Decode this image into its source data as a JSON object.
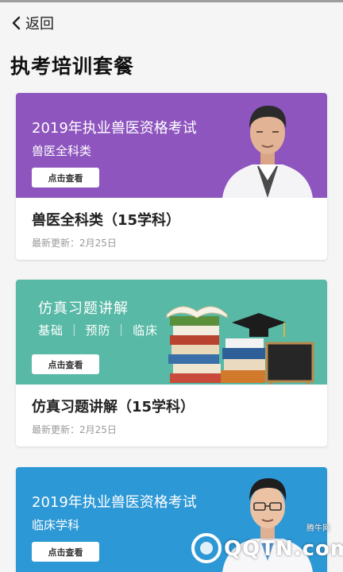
{
  "nav": {
    "back_label": "返回"
  },
  "page": {
    "title": "执考培训套餐"
  },
  "colors": {
    "purple": "#8e55bf",
    "teal": "#58b9a6",
    "blue": "#2d98d6"
  },
  "cards": [
    {
      "banner_title": "2019年执业兽医资格考试",
      "banner_subtitle": "兽医全科类",
      "button_label": "点击查看",
      "name": "兽医全科类（15学科）",
      "updated": "最新更新：2月25日",
      "image": "teacher-portrait"
    },
    {
      "banner_title": "仿真习题讲解",
      "banner_subtitle": "基础 ｜ 预防 ｜ 临床",
      "button_label": "点击查看",
      "name": "仿真习题讲解（15学科）",
      "updated": "最新更新：2月25日",
      "image": "books-and-graduation-cap"
    },
    {
      "banner_title": "2019年执业兽医资格考试",
      "banner_subtitle": "临床学科",
      "button_label": "点击查看",
      "image": "teacher-portrait"
    }
  ],
  "watermark": {
    "brand": "QQTN.com",
    "caption": "腾牛网"
  }
}
